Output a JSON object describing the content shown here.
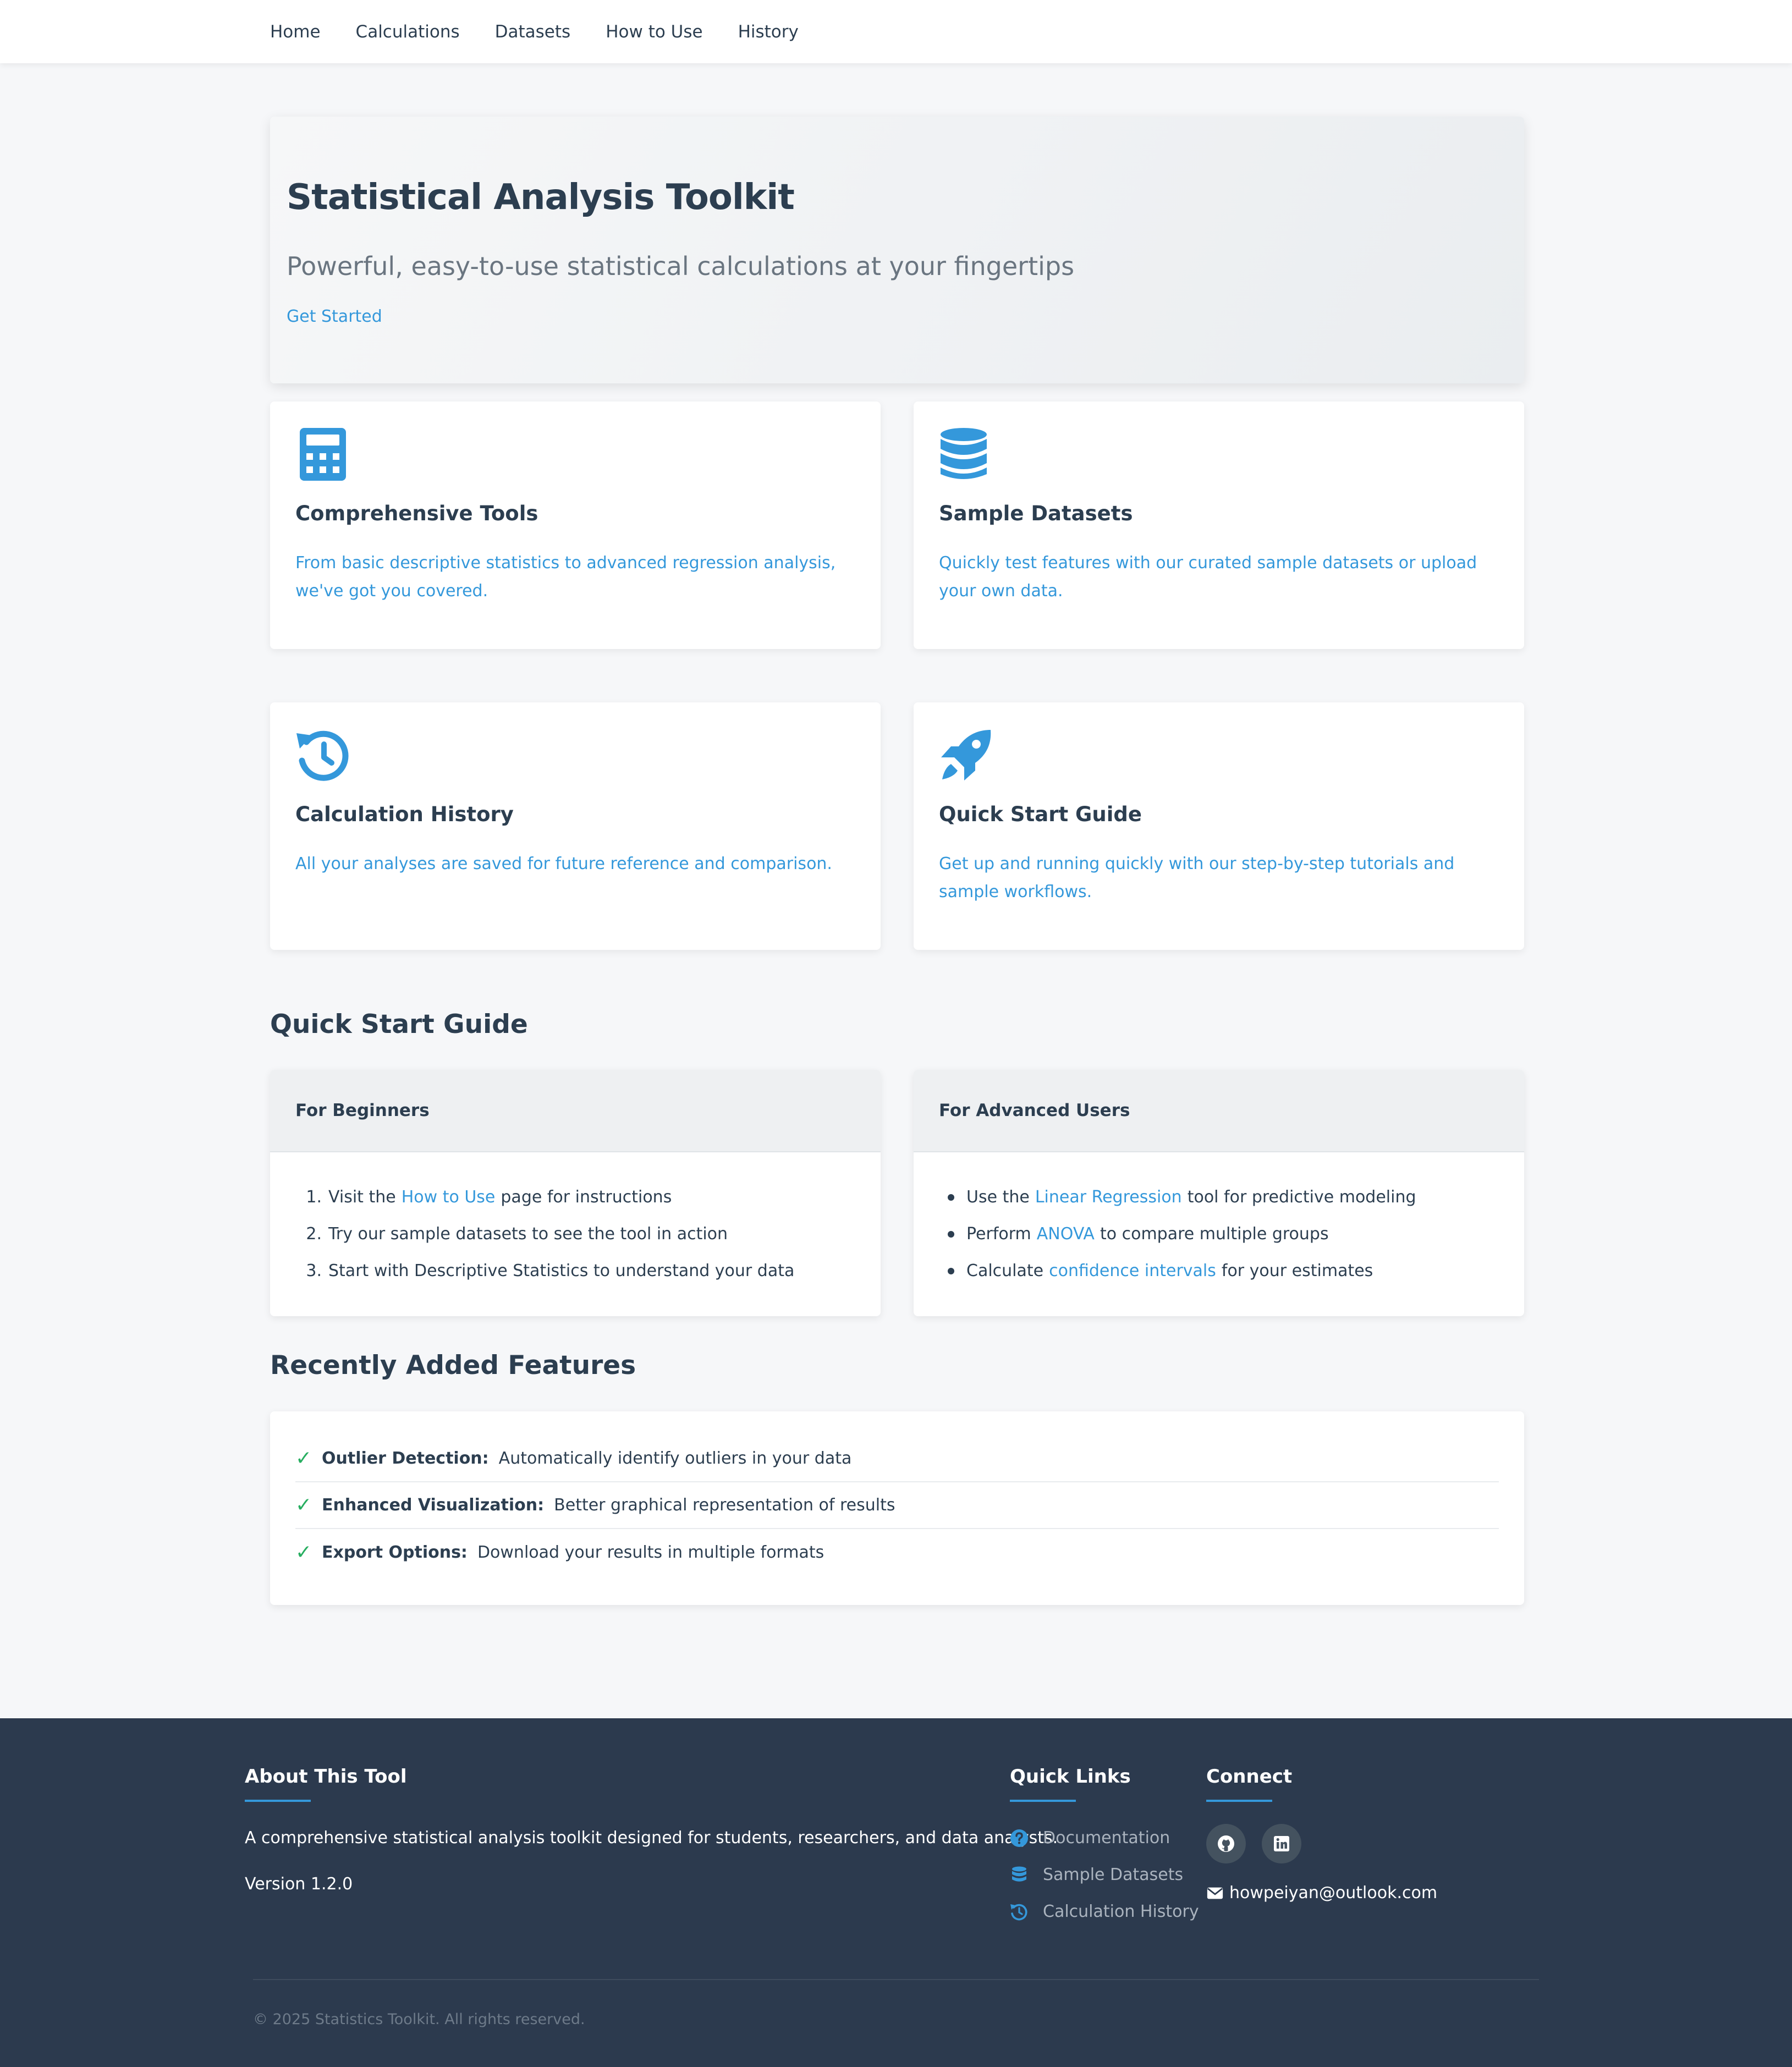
{
  "nav": {
    "items": [
      {
        "label": "Home"
      },
      {
        "label": "Calculations"
      },
      {
        "label": "Datasets"
      },
      {
        "label": "How to Use"
      },
      {
        "label": "History"
      }
    ]
  },
  "hero": {
    "title": "Statistical Analysis Toolkit",
    "subtitle": "Powerful, easy-to-use statistical calculations at your fingertips",
    "cta": "Get Started"
  },
  "features": [
    {
      "icon": "calculator-icon",
      "title": "Comprehensive Tools",
      "text": "From basic descriptive statistics to advanced regression analysis, we've got you covered."
    },
    {
      "icon": "database-icon",
      "title": "Sample Datasets",
      "text": "Quickly test features with our curated sample datasets or upload your own data."
    },
    {
      "icon": "history-icon",
      "title": "Calculation History",
      "text": "All your analyses are saved for future reference and comparison."
    },
    {
      "icon": "rocket-icon",
      "title": "Quick Start Guide",
      "text": "Get up and running quickly with our step-by-step tutorials and sample workflows."
    }
  ],
  "quick_start": {
    "heading": "Quick Start Guide",
    "beginners": {
      "title": "For Beginners",
      "items": [
        {
          "num": "1.",
          "before": "Visit the",
          "link": "How to Use",
          "after": "page for instructions"
        },
        {
          "num": "2.",
          "text": "Try our sample datasets to see the tool in action"
        },
        {
          "num": "3.",
          "text": "Start with Descriptive Statistics to understand your data"
        }
      ]
    },
    "advanced": {
      "title": "For Advanced Users",
      "items": [
        {
          "before": "Use the",
          "link": "Linear Regression",
          "after": "tool for predictive modeling"
        },
        {
          "before": "Perform",
          "link": "ANOVA",
          "after": "to compare multiple groups"
        },
        {
          "before": "Calculate",
          "link": "confidence intervals",
          "after": "for your estimates"
        }
      ]
    }
  },
  "recent": {
    "heading": "Recently Added Features",
    "check": "✓",
    "items": [
      {
        "name": "Outlier Detection:",
        "desc": "Automatically identify outliers in your data"
      },
      {
        "name": "Enhanced Visualization:",
        "desc": "Better graphical representation of results"
      },
      {
        "name": "Export Options:",
        "desc": "Download your results in multiple formats"
      }
    ]
  },
  "footer": {
    "about": {
      "heading": "About This Tool",
      "text": "A comprehensive statistical analysis toolkit designed for students, researchers, and data analysts.",
      "version": "Version 1.2.0"
    },
    "quick_links": {
      "heading": "Quick Links",
      "items": [
        {
          "icon": "question-circle-icon",
          "label": "Documentation"
        },
        {
          "icon": "database-icon",
          "label": "Sample Datasets"
        },
        {
          "icon": "history-icon",
          "label": "Calculation History"
        }
      ]
    },
    "connect": {
      "heading": "Connect",
      "social": [
        {
          "icon": "github-icon"
        },
        {
          "icon": "linkedin-icon"
        }
      ],
      "email": "howpeiyan@outlook.com"
    },
    "copyright": "© 2025 Statistics Toolkit. All rights reserved."
  },
  "colors": {
    "accent": "#3498db",
    "heading": "#2c3e50",
    "check": "#27ae60",
    "footer_bg": "#2c3a4e"
  }
}
